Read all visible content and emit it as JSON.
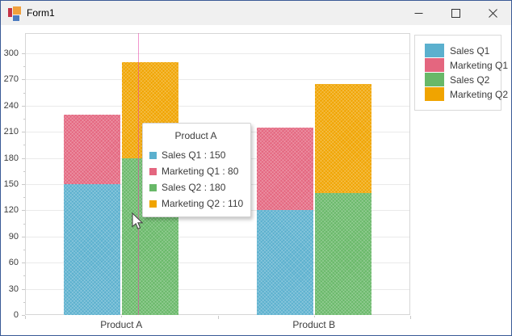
{
  "window": {
    "title": "Form1",
    "controls": [
      {
        "name": "minimize"
      },
      {
        "name": "maximize"
      },
      {
        "name": "close"
      }
    ]
  },
  "chart_data": {
    "type": "bar",
    "stacked": true,
    "title": "",
    "xlabel": "",
    "ylabel": "",
    "categories": [
      "Product A",
      "Product B"
    ],
    "series": [
      {
        "name": "Sales Q1",
        "stack": "Q1",
        "color": "#5bb0ce",
        "values": [
          150,
          120
        ]
      },
      {
        "name": "Marketing Q1",
        "stack": "Q1",
        "color": "#e4667f",
        "values": [
          80,
          95
        ]
      },
      {
        "name": "Sales Q2",
        "stack": "Q2",
        "color": "#68b868",
        "values": [
          180,
          140
        ]
      },
      {
        "name": "Marketing Q2",
        "stack": "Q2",
        "color": "#f0a400",
        "values": [
          110,
          125
        ]
      }
    ],
    "ylim": [
      0,
      300
    ],
    "yticks": [
      0,
      30,
      60,
      90,
      120,
      150,
      180,
      210,
      240,
      270,
      300
    ],
    "grid": true,
    "legend_position": "top-right"
  },
  "tooltip": {
    "title": "Product A",
    "separator": " : ",
    "items": [
      {
        "label": "Sales Q1",
        "value": "150",
        "color": "#5bb0ce"
      },
      {
        "label": "Marketing Q1",
        "value": "80",
        "color": "#e4667f"
      },
      {
        "label": "Sales Q2",
        "value": "180",
        "color": "#68b868"
      },
      {
        "label": "Marketing Q2",
        "value": "110",
        "color": "#f0a400"
      }
    ]
  },
  "colors": {
    "crosshair": "#e83ea6",
    "window_border": "#3a5a96",
    "titlebar_bg": "#f0f0f0",
    "gridline": "#eaeaea",
    "axis": "#c9c9c9"
  }
}
